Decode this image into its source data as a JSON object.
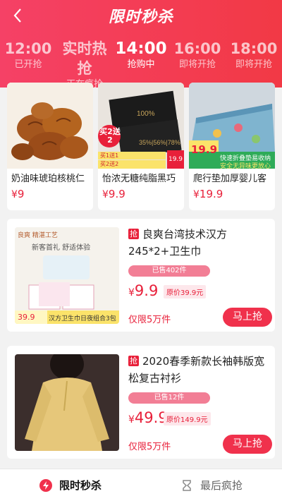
{
  "header": {
    "title": "限时秒杀"
  },
  "tabs": [
    {
      "time": "12:00",
      "status": "已开抢"
    },
    {
      "time": "实时热抢",
      "status": "正在疯抢"
    },
    {
      "time": "14:00",
      "status": "抢购中"
    },
    {
      "time": "16:00",
      "status": "即将开抢"
    },
    {
      "time": "18:00",
      "status": "即将开抢"
    }
  ],
  "cards": [
    {
      "name": "奶油味琥珀核桃仁",
      "currency": "¥",
      "price": "9"
    },
    {
      "name": "怡浓无糖纯脂黑巧",
      "currency": "¥",
      "price": "9.9",
      "badge": "买2送2",
      "promo1": "买1送1",
      "promo2": "买2送2",
      "img_price": "19.9"
    },
    {
      "name": "爬行垫加厚婴儿客",
      "currency": "¥",
      "price": "19.9",
      "img_price": "19.9",
      "banner": "快速折叠垫易收纳",
      "banner2": "安全无异味更放心"
    }
  ],
  "items": [
    {
      "tag": "抢",
      "name": "良爽台湾技术汉方245*2+卫生巾",
      "sold": "已售402件",
      "currency": "¥",
      "price": "9.9",
      "original": "原价39.9元",
      "limit": "仅限5万件",
      "buy": "马上抢",
      "img_top": "良爽 精湛工艺",
      "img_mid": "新客首礼 舒适体验",
      "img_price": "39.9",
      "img_desc": "汉方卫生巾日夜组合3包"
    },
    {
      "tag": "抢",
      "name": "2020春季新款长袖韩版宽松复古衬衫",
      "sold": "已售12件",
      "currency": "¥",
      "price": "49.9",
      "original": "原价149.9元",
      "limit": "仅限5万件",
      "buy": "马上抢"
    }
  ],
  "bottom_nav": [
    {
      "label": "限时秒杀",
      "icon": "lightning-icon"
    },
    {
      "label": "最后疯抢",
      "icon": "hourglass-icon"
    }
  ],
  "colors": {
    "accent": "#f0314c",
    "header": "#f23a52"
  }
}
